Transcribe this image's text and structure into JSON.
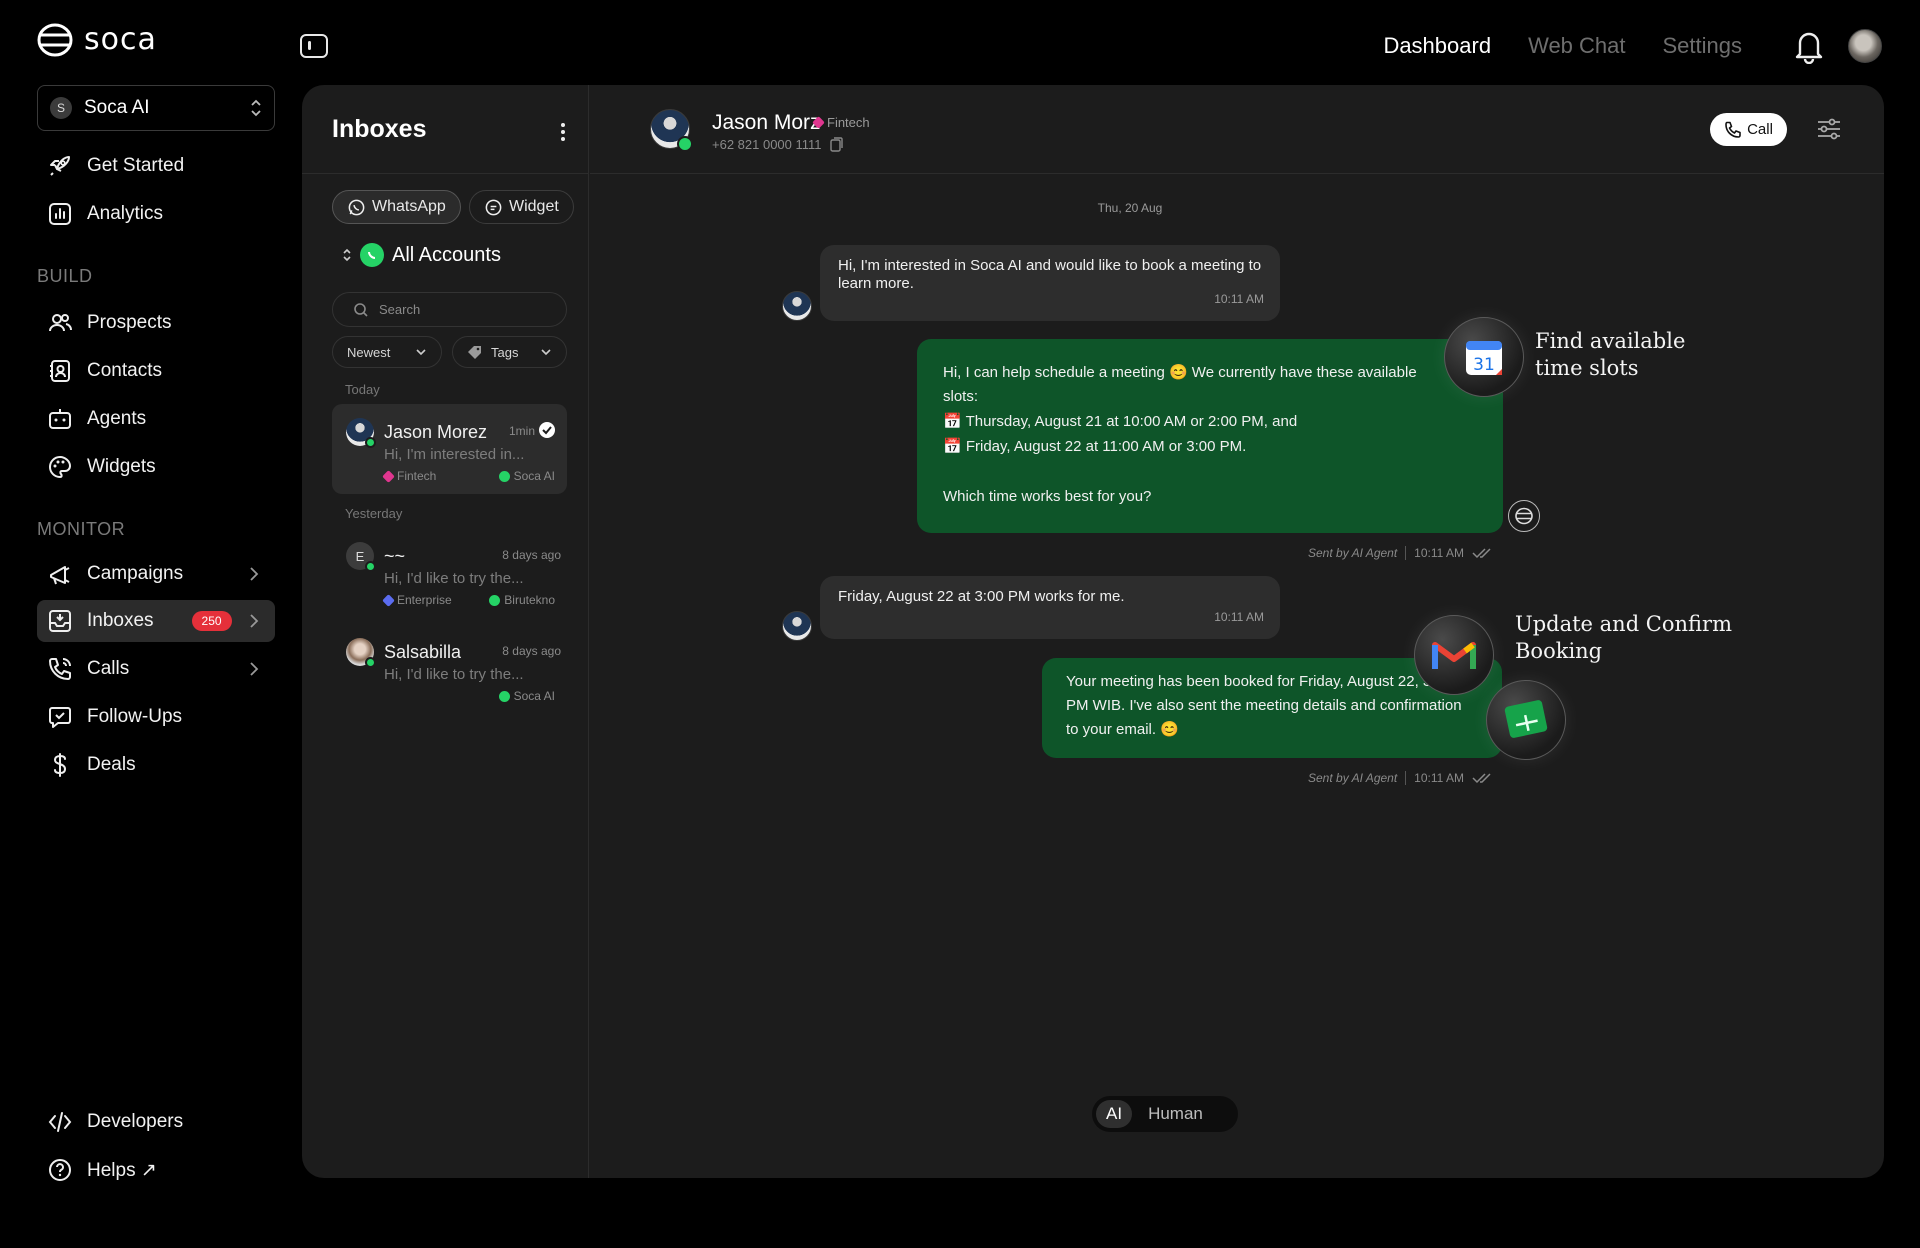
{
  "brand": {
    "name": "soca"
  },
  "topnav": {
    "dashboard": "Dashboard",
    "web_chat": "Web Chat",
    "settings": "Settings"
  },
  "workspace": {
    "initial": "S",
    "name": "Soca AI"
  },
  "sidebar": {
    "get_started": "Get Started",
    "analytics": "Analytics",
    "build_label": "BUILD",
    "prospects": "Prospects",
    "contacts": "Contacts",
    "agents": "Agents",
    "widgets": "Widgets",
    "monitor_label": "MONITOR",
    "campaigns": "Campaigns",
    "inboxes": "Inboxes",
    "inboxes_badge": "250",
    "calls": "Calls",
    "follow_ups": "Follow-Ups",
    "deals": "Deals",
    "developers": "Developers",
    "helps": "Helps ↗"
  },
  "inbox": {
    "title": "Inboxes",
    "chip_whatsapp": "WhatsApp",
    "chip_widget": "Widget",
    "accounts": "All Accounts",
    "search_placeholder": "Search",
    "filter_sort": "Newest",
    "filter_tags": "Tags",
    "today": "Today",
    "yesterday": "Yesterday",
    "conversations": [
      {
        "name": "Jason Morez",
        "time": "1min",
        "preview": "Hi, I'm interested in...",
        "tag": "Fintech",
        "account": "Soca AI",
        "tag_color": "#e0368f"
      },
      {
        "name": "~~",
        "initial": "E",
        "time": "8 days ago",
        "preview": "Hi, I'd like to try the...",
        "tag": "Enterprise",
        "account": "Birutekno",
        "tag_color": "#5b6cf0"
      },
      {
        "name": "Salsabilla",
        "time": "8 days ago",
        "preview": "Hi, I'd like to try the...",
        "account": "Soca AI"
      }
    ]
  },
  "chat": {
    "name": "Jason Morz",
    "tag": "Fintech",
    "phone": "+62 821 0000 1111",
    "call": "Call",
    "date": "Thu, 20 Aug",
    "msg1": "Hi, I'm interested in Soca AI and would like to book a meeting to learn more.",
    "msg1_time": "10:11 AM",
    "msg2_line1": "Hi, I can help schedule a meeting 😊 We currently have these available slots:",
    "msg2_line2": "📅 Thursday, August 21 at 10:00 AM or 2:00 PM, and",
    "msg2_line3": "📅 Friday, August 22 at 11:00 AM or 3:00 PM.",
    "msg2_line4": "Which time works best for you?",
    "sent_by": "Sent by AI Agent",
    "msg2_time": "10:11 AM",
    "msg3": "Friday, August 22 at 3:00 PM works for me.",
    "msg3_time": "10:11 AM",
    "msg4": "Your meeting has been booked for Friday, August 22, 3:00 PM WIB. I've also sent the meeting details and confirmation to your email. 😊",
    "msg4_time": "10:11 AM",
    "callout1": "Find available time slots",
    "callout2": "Update and Confirm Booking",
    "calendar_day": "31",
    "mode_ai": "AI",
    "mode_human": "Human"
  }
}
